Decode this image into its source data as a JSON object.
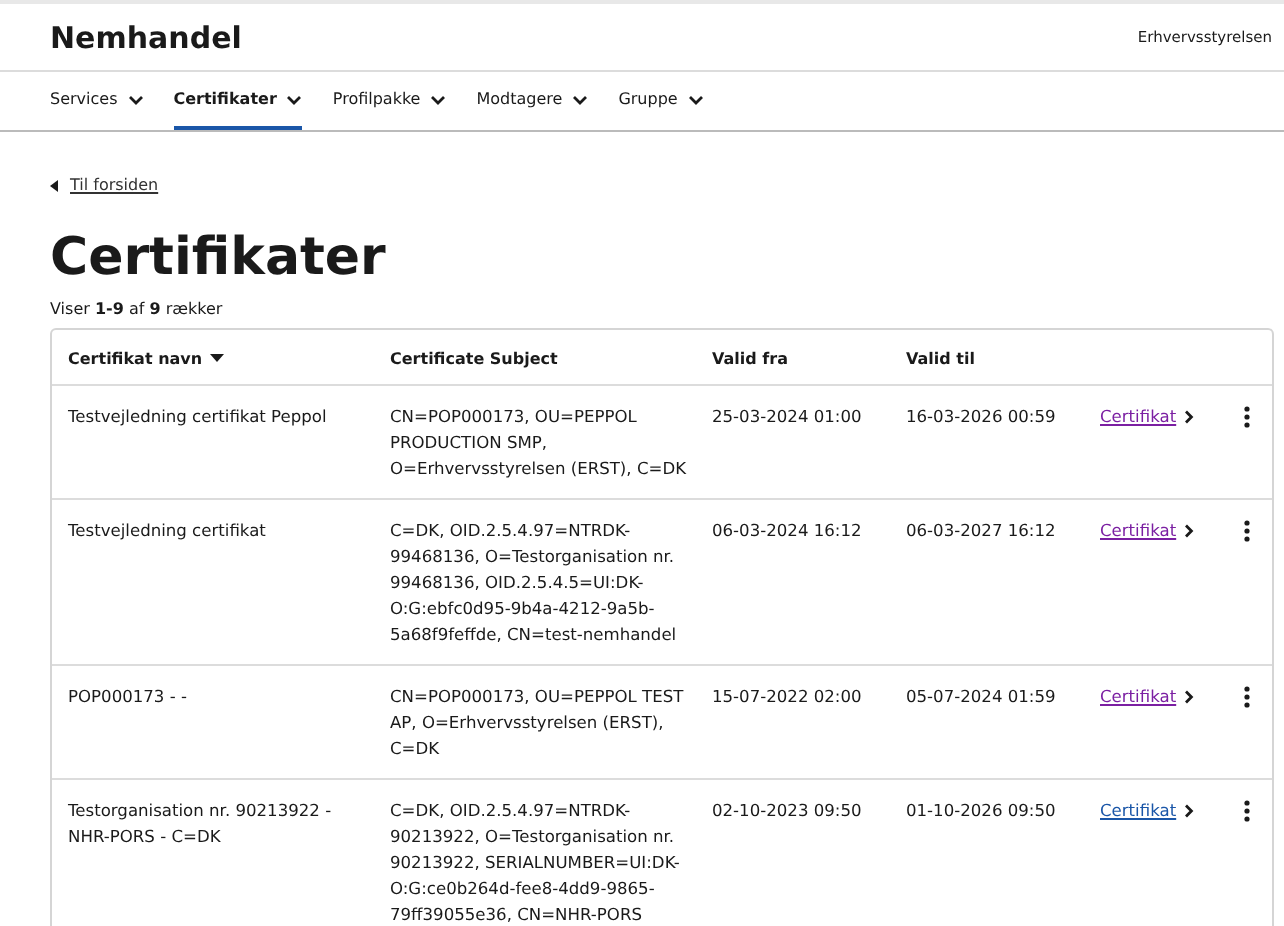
{
  "header": {
    "title": "Nemhandel",
    "organization": "Erhvervsstyrelsen"
  },
  "nav": [
    {
      "label": "Services",
      "selected": false
    },
    {
      "label": "Certifikater",
      "selected": true
    },
    {
      "label": "Profilpakke",
      "selected": false
    },
    {
      "label": "Modtagere",
      "selected": false
    },
    {
      "label": "Gruppe",
      "selected": false
    }
  ],
  "back_link": "Til forsiden",
  "page_title": "Certifikater",
  "summary": "Viser **1-9** af **9** rækker",
  "table": {
    "columns": [
      "Certifikat navn",
      "Certificate Subject",
      "Valid fra",
      "Valid til"
    ],
    "rows": [
      {
        "name": "Testvejledning certifikat Peppol",
        "subject": "CN=POP000173, OU=PEPPOL PRODUCTION SMP, O=Erhvervsstyrelsen (ERST), C=DK",
        "valid_from": "25-03-2024 01:00",
        "valid_to": "16-03-2026 00:59",
        "link": "Certifikat",
        "visited": true
      },
      {
        "name": "Testvejledning certifikat",
        "subject": "C=DK, OID.2.5.4.97=NTRDK-99468136, O=Testorganisation nr. 99468136, OID.2.5.4.5=UI:DK-O:G:ebfc0d95-9b4a-4212-9a5b-5a68f9feffde, CN=test-nemhandel",
        "valid_from": "06-03-2024 16:12",
        "valid_to": "06-03-2027 16:12",
        "link": "Certifikat",
        "visited": true
      },
      {
        "name": "POP000173 - -",
        "subject": "CN=POP000173, OU=PEPPOL TEST AP, O=Erhvervsstyrelsen (ERST), C=DK",
        "valid_from": "15-07-2022 02:00",
        "valid_to": "05-07-2024 01:59",
        "link": "Certifikat",
        "visited": true
      },
      {
        "name": "Testorganisation nr. 90213922 - NHR-PORS - C=DK",
        "subject": "C=DK, OID.2.5.4.97=NTRDK-90213922, O=Testorganisation nr. 90213922, SERIALNUMBER=UI:DK-O:G:ce0b264d-fee8-4dd9-9865-79ff39055e36, CN=NHR-PORS",
        "valid_from": "02-10-2023 09:50",
        "valid_to": "01-10-2026 09:50",
        "link": "Certifikat",
        "visited": false
      }
    ]
  }
}
